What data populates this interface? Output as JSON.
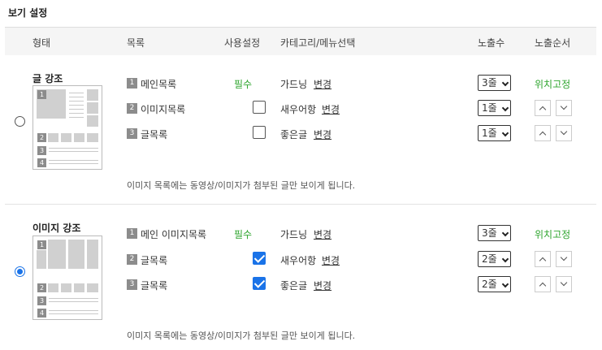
{
  "title": "보기 설정",
  "header": {
    "form": "형태",
    "list": "목록",
    "use": "사용설정",
    "category": "카테고리/메뉴선택",
    "count": "노출수",
    "order": "노출순서"
  },
  "sections": [
    {
      "label": "글 강조",
      "selected": false,
      "rows": [
        {
          "num": "1",
          "name": "메인목록",
          "required": "필수",
          "checked": null,
          "category": "가드닝",
          "change": "변경",
          "count": "3줄",
          "fixed": "위치고정"
        },
        {
          "num": "2",
          "name": "이미지목록",
          "required": null,
          "checked": false,
          "category": "새우어항",
          "change": "변경",
          "count": "1줄",
          "fixed": null
        },
        {
          "num": "3",
          "name": "글목록",
          "required": null,
          "checked": false,
          "category": "좋은글",
          "change": "변경",
          "count": "1줄",
          "fixed": null
        }
      ],
      "note": "이미지 목록에는 동영상/이미지가 첨부된 글만 보이게 됩니다."
    },
    {
      "label": "이미지 강조",
      "selected": true,
      "rows": [
        {
          "num": "1",
          "name": "메인 이미지목록",
          "required": "필수",
          "checked": null,
          "category": "가드닝",
          "change": "변경",
          "count": "3줄",
          "fixed": "위치고정"
        },
        {
          "num": "2",
          "name": "글목록",
          "required": null,
          "checked": true,
          "category": "새우어항",
          "change": "변경",
          "count": "2줄",
          "fixed": null
        },
        {
          "num": "3",
          "name": "글목록",
          "required": null,
          "checked": true,
          "category": "좋은글",
          "change": "변경",
          "count": "2줄",
          "fixed": null
        }
      ],
      "note": "이미지 목록에는 동영상/이미지가 첨부된 글만 보이게 됩니다."
    }
  ],
  "thumb1_nums": [
    "1",
    "2",
    "3",
    "4"
  ],
  "thumb2_nums": [
    "1",
    "2",
    "3",
    "4"
  ],
  "colors": {
    "accent": "#1a73e8",
    "required": "#2ea52e"
  }
}
